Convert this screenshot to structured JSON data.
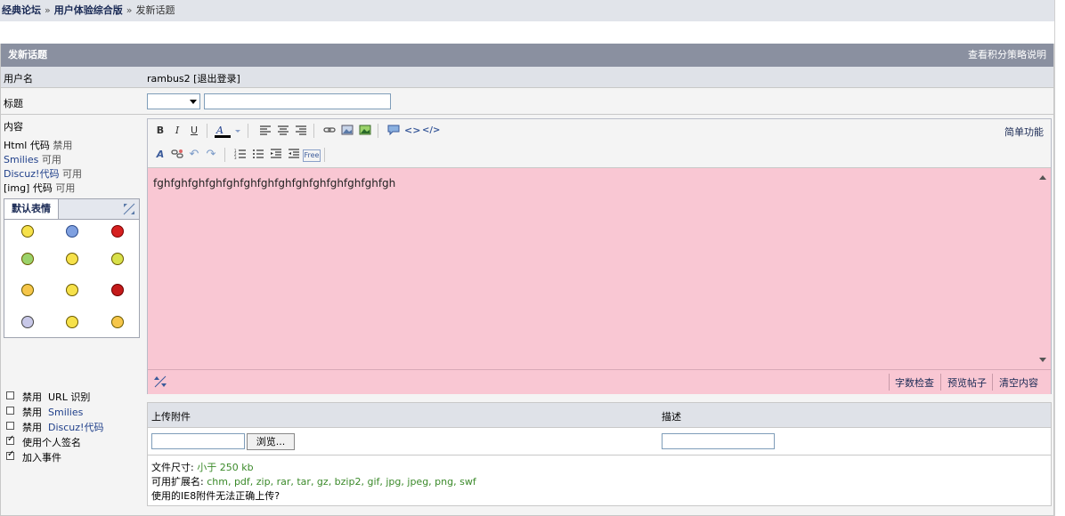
{
  "breadcrumb": {
    "home": "经典论坛",
    "forum": "用户体验综合版",
    "current": "发新话题",
    "sep": "»"
  },
  "header": {
    "title": "发新话题",
    "right_link": "查看积分策略说明"
  },
  "user_row": {
    "label": "用户名",
    "username": "rambus2",
    "logout": "[退出登录]"
  },
  "subject_row": {
    "label": "标题",
    "type_value": "",
    "subject_value": ""
  },
  "content_side": {
    "label": "内容",
    "html_code": "Html 代码",
    "html_state": "禁用",
    "smilies": "Smilies",
    "smilies_state": "可用",
    "discuz_code": "Discuz!代码",
    "discuz_state": "可用",
    "img_code": "[img] 代码",
    "img_state": "可用",
    "smiley_tab": "默认表情",
    "smileys": [
      "smile",
      "frown-blue",
      "angry-red",
      "grin-teeth",
      "smile",
      "smile-green",
      "cool",
      "laugh",
      "mad-red",
      "dizzy",
      "shocked",
      "wink"
    ]
  },
  "options": [
    {
      "prefix": "禁用",
      "text": "URL 识别",
      "checked": false,
      "blue": false
    },
    {
      "prefix": "禁用",
      "text": "Smilies",
      "checked": false,
      "blue": true
    },
    {
      "prefix": "禁用",
      "text": "Discuz!代码",
      "checked": false,
      "blue": true
    },
    {
      "prefix": "",
      "text": "使用个人签名",
      "checked": true,
      "blue": false
    },
    {
      "prefix": "",
      "text": "加入事件",
      "checked": true,
      "blue": false
    }
  ],
  "editor": {
    "simple_mode": "简单功能",
    "content": "fghfghfghfghfghfghfghfghfghfghfghfghfghfgh",
    "word_check": "字数检查",
    "preview": "预览帖子",
    "clear": "清空内容",
    "toolbar1": [
      "bold",
      "italic",
      "underline",
      "font-color",
      "align-left",
      "align-center",
      "align-right",
      "link",
      "image",
      "insert-image",
      "quote",
      "code",
      "html"
    ],
    "toolbar2": [
      "remove-format",
      "unlink",
      "undo",
      "redo",
      "ordered-list",
      "unordered-list",
      "outdent",
      "indent",
      "free"
    ]
  },
  "attachment": {
    "upload_label": "上传附件",
    "desc_label": "描述",
    "browse": "浏览...",
    "size_label": "文件尺寸:",
    "size_value": "小于  250 kb",
    "ext_label": "可用扩展名:",
    "ext_value": "chm, pdf, zip, rar, tar, gz, bzip2, gif, jpg, jpeg, png, swf",
    "ie8_note": "使用的IE8附件无法正确上传?"
  },
  "colors": {
    "header_bg": "#8a90a0",
    "editor_bg": "#f9c7d3",
    "row_bg": "#dfe2e8"
  }
}
